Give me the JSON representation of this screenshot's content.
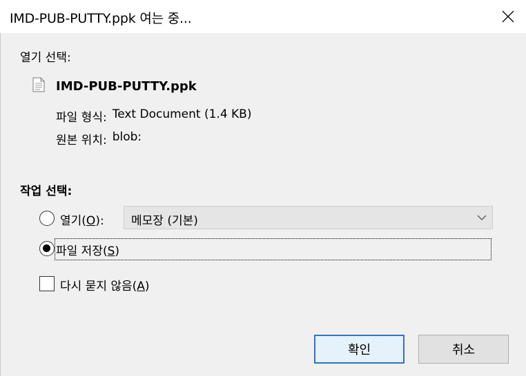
{
  "window": {
    "title": "IMD-PUB-PUTTY.ppk 여는 중..."
  },
  "icons": {
    "close": "close-icon",
    "file": "document-icon",
    "dropdown": "chevron-down-icon"
  },
  "open_section": {
    "label": "열기 선택:",
    "file_name": "IMD-PUB-PUTTY.ppk",
    "file_type_label": "파일 형식:",
    "file_type_value": "Text Document (1.4 KB)",
    "origin_label": "원본 위치:",
    "origin_value": "blob:"
  },
  "action_section": {
    "label": "작업 선택:",
    "open_option": {
      "text": "열기(",
      "mnemonic": "O",
      "suffix": "):",
      "checked": false
    },
    "open_with_select": {
      "value": "메모장 (기본)"
    },
    "save_option": {
      "text": "파일 저장(",
      "mnemonic": "S",
      "suffix": ")",
      "checked": true
    },
    "dont_ask": {
      "text": "다시 묻지 않음(",
      "mnemonic": "A",
      "suffix": ")",
      "checked": false
    }
  },
  "buttons": {
    "ok": "확인",
    "cancel": "취소"
  },
  "colors": {
    "accent": "#2f73c0",
    "dialog_bg": "#f0f0f0"
  }
}
